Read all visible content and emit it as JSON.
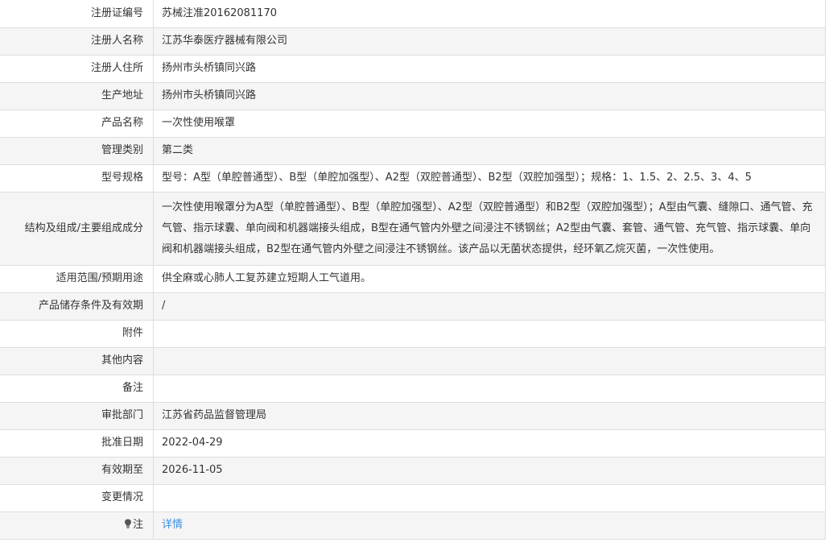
{
  "rows": [
    {
      "label": "注册证编号",
      "value": "苏械注准20162081170"
    },
    {
      "label": "注册人名称",
      "value": "江苏华泰医疗器械有限公司"
    },
    {
      "label": "注册人住所",
      "value": "扬州市头桥镇同兴路"
    },
    {
      "label": "生产地址",
      "value": "扬州市头桥镇同兴路"
    },
    {
      "label": "产品名称",
      "value": "一次性使用喉罩"
    },
    {
      "label": "管理类别",
      "value": "第二类"
    },
    {
      "label": "型号规格",
      "value": "型号：A型（单腔普通型）、B型（单腔加强型）、A2型（双腔普通型）、B2型（双腔加强型）；规格：1、1.5、2、2.5、3、4、5"
    },
    {
      "label": "结构及组成/主要组成成分",
      "value": "一次性使用喉罩分为A型（单腔普通型）、B型（单腔加强型）、A2型（双腔普通型）和B2型（双腔加强型）；A型由气囊、缝隙口、通气管、充气管、指示球囊、单向阀和机器端接头组成，B型在通气管内外壁之间浸注不锈钢丝；A2型由气囊、套管、通气管、充气管、指示球囊、单向阀和机器端接头组成，B2型在通气管内外壁之间浸注不锈钢丝。该产品以无菌状态提供，经环氧乙烷灭菌，一次性使用。"
    },
    {
      "label": "适用范围/预期用途",
      "value": "供全麻或心肺人工复苏建立短期人工气道用。"
    },
    {
      "label": "产品储存条件及有效期",
      "value": "/"
    },
    {
      "label": "附件",
      "value": ""
    },
    {
      "label": "其他内容",
      "value": ""
    },
    {
      "label": "备注",
      "value": ""
    },
    {
      "label": "审批部门",
      "value": "江苏省药品监督管理局"
    },
    {
      "label": "批准日期",
      "value": "2022-04-29"
    },
    {
      "label": "有效期至",
      "value": "2026-11-05"
    },
    {
      "label": "变更情况",
      "value": ""
    }
  ],
  "note": {
    "icon": "lightbulb-icon",
    "label": "注",
    "link_text": "详情",
    "link_color": "#3a8ee6"
  },
  "colors": {
    "border": "#dddddd",
    "row_alt": "#f5f5f5",
    "text": "#333333"
  }
}
